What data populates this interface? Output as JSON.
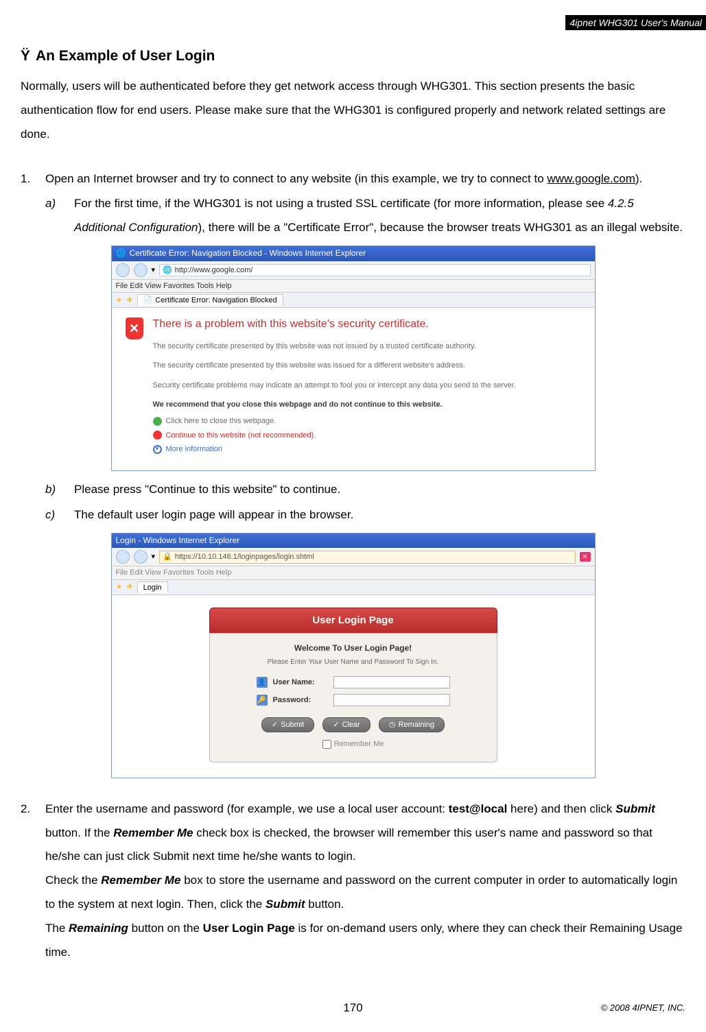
{
  "header": {
    "product": "4ipnet WHG301 User's Manual"
  },
  "section": {
    "bullet": "Ÿ",
    "title": "An Example of User Login",
    "intro": "Normally, users will be authenticated before they get network access through WHG301. This section presents the basic authentication flow for end users. Please make sure that the WHG301 is configured properly and network related settings are done."
  },
  "step1": {
    "num": "1.",
    "text_a": "Open an Internet browser and try to connect to any website (in this example, we try to connect to ",
    "link": "www.google.com",
    "text_b": ").",
    "a": {
      "mark": "a)",
      "t1": "For the first time, if the WHG301 is not using a trusted SSL certificate (for more information, please see ",
      "ref": "4.2.5 Additional Configuration",
      "t2": "), there will be a \"Certificate Error\", because the browser treats WHG301 as an illegal website."
    },
    "b": {
      "mark": "b)",
      "text": "Please press \"Continue to this website\" to continue."
    },
    "c": {
      "mark": "c)",
      "text": "The default user login page will appear in the browser."
    }
  },
  "shot1": {
    "title": "Certificate Error: Navigation Blocked - Windows Internet Explorer",
    "url": "http://www.google.com/",
    "menus": "File   Edit   View   Favorites   Tools   Help",
    "tab": "Certificate Error: Navigation Blocked",
    "h1": "There is a problem with this website's security certificate.",
    "p1": "The security certificate presented by this website was not issued by a trusted certificate authority.",
    "p2": "The security certificate presented by this website was issued for a different website's address.",
    "p3": "Security certificate problems may indicate an attempt to fool you or intercept any data you send to the server.",
    "rec": "We recommend that you close this webpage and do not continue to this website.",
    "close": "Click here to close this webpage.",
    "cont": "Continue to this website (not recommended).",
    "more": "More information"
  },
  "shot2": {
    "title": "Login - Windows Internet Explorer",
    "url": "https://10.10.146.1/loginpages/login.shtml",
    "menus": "File   Edit   View   Favorites   Tools   Help",
    "tab": "Login",
    "panel_title": "User Login Page",
    "welcome": "Welcome To User Login Page!",
    "instruct": "Please Enter Your User Name and Password To Sign In.",
    "uname_label": "User Name:",
    "pwd_label": "Password:",
    "btn_submit": "Submit",
    "btn_clear": "Clear",
    "btn_remaining": "Remaining",
    "remember": "Remember Me"
  },
  "step2": {
    "num": "2.",
    "t1": "Enter the username and password (for example, we use a local user account: ",
    "acct": "test@local",
    "t2": " here) and then click ",
    "submit1": "Submit",
    "t3": " button. If the ",
    "rm1": "Remember Me",
    "t4": " check box is checked, the browser will remember this user's name and password so that he/she can just click Submit next time he/she wants to login.",
    "t5": "Check the ",
    "rm2": "Remember Me",
    "t6": " box to store the username and password on the current computer in order to automatically login to the system at next login. Then, click the ",
    "submit2": "Submit",
    "t7": " button.",
    "t8": "The ",
    "remaining": "Remaining",
    "t9": " button on the ",
    "ulp": "User Login Page",
    "t10": " is for on-demand users only, where they can check their Remaining Usage time."
  },
  "footer": {
    "page": "170",
    "copy": "© 2008 4IPNET, INC."
  }
}
